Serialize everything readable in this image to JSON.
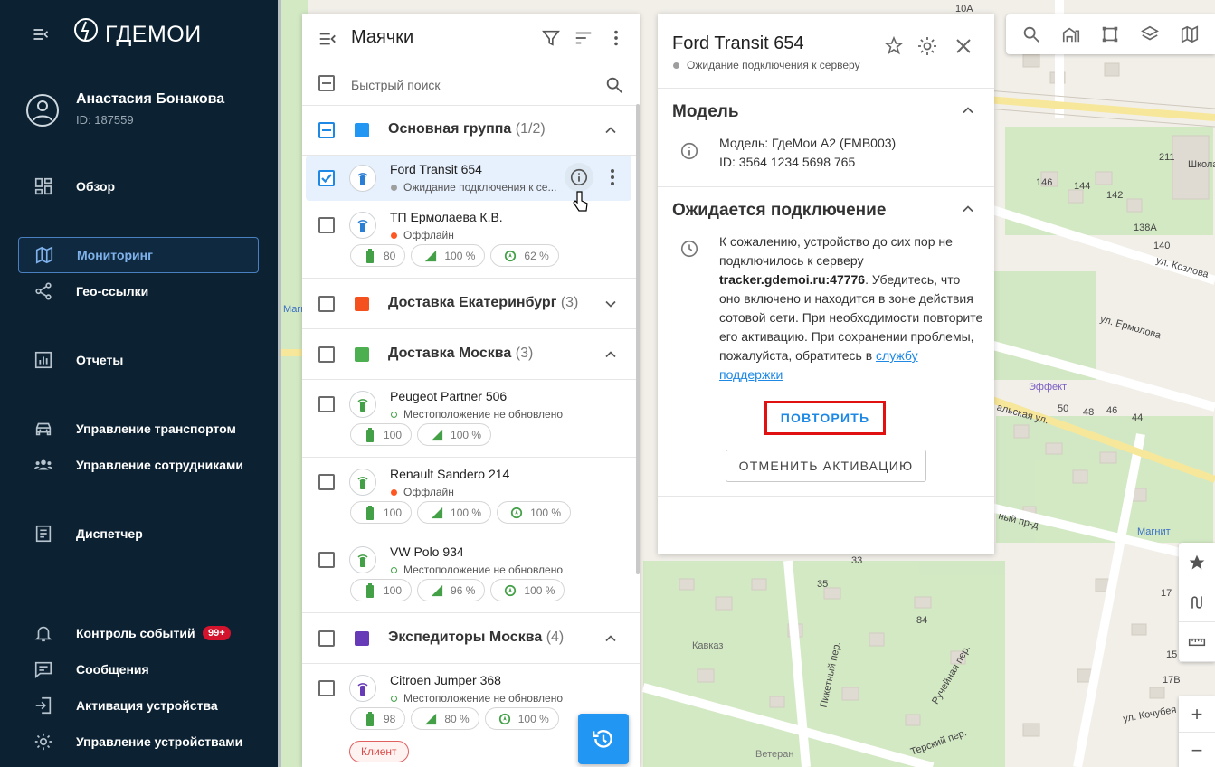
{
  "app": {
    "logo_text": "ГДЕМОИ"
  },
  "user": {
    "name": "Анастасия Бонакова",
    "id": "ID: 187559"
  },
  "nav": [
    {
      "key": "overview",
      "label": "Обзор",
      "icon": "dashboard-icon"
    },
    {
      "key": "monitoring",
      "label": "Мониторинг",
      "icon": "map-icon",
      "active": true
    },
    {
      "key": "geolinks",
      "label": "Гео-ссылки",
      "icon": "share-icon"
    },
    {
      "key": "reports",
      "label": "Отчеты",
      "icon": "reports-icon"
    },
    {
      "key": "vehicles",
      "label": "Управление транспортом",
      "icon": "car-icon"
    },
    {
      "key": "employees",
      "label": "Управление сотрудниками",
      "icon": "people-icon"
    },
    {
      "key": "dispatcher",
      "label": "Диспетчер",
      "icon": "clipboard-icon"
    },
    {
      "key": "events",
      "label": "Контроль событий",
      "icon": "bell-icon",
      "badge": "99+"
    },
    {
      "key": "messages",
      "label": "Сообщения",
      "icon": "message-icon"
    },
    {
      "key": "activation",
      "label": "Активация устройства",
      "icon": "login-icon"
    },
    {
      "key": "devices",
      "label": "Управление устройствами",
      "icon": "gear-icon"
    }
  ],
  "panel": {
    "title": "Маячки",
    "search_placeholder": "Быстрый поиск",
    "groups": [
      {
        "name": "Основная группа",
        "count": "(1/2)",
        "color": "#2196f3"
      },
      {
        "name": "Доставка Екатеринбург",
        "count": "(3)",
        "color": "#f4511e"
      },
      {
        "name": "Доставка Москва",
        "count": "(3)",
        "color": "#4caf50"
      },
      {
        "name": "Экспедиторы Москва",
        "count": "(4)",
        "color": "#673ab7"
      }
    ],
    "trackers": [
      {
        "name": "Ford Transit 654",
        "status": "Ожидание подключения к се..."
      },
      {
        "name": "ТП Ермолаева К.В.",
        "status": "Оффлайн",
        "battery": "80",
        "signal": "100 %",
        "gps": "62 %"
      },
      {
        "name": "Peugeot Partner 506",
        "status": "Местоположение не обновлено",
        "battery": "100",
        "signal": "100 %"
      },
      {
        "name": "Renault Sandero 214",
        "status": "Оффлайн",
        "battery": "100",
        "signal": "100 %",
        "gps": "100 %"
      },
      {
        "name": "VW Polo 934",
        "status": "Местоположение не обновлено",
        "battery": "100",
        "signal": "96 %",
        "gps": "100 %"
      },
      {
        "name": "Citroen Jumper 368",
        "status": "Местоположение не обновлено",
        "battery": "98",
        "signal": "80 %",
        "gps": "100 %",
        "tag": "Клиент"
      }
    ]
  },
  "details": {
    "title": "Ford Transit 654",
    "status": "Ожидание подключения к серверу",
    "model_header": "Модель",
    "model_line": "Модель: ГдеМои А2 (FMB003)",
    "id_line": "ID: 3564 1234 5698 765",
    "wait_header": "Ожидается подключение",
    "wait_text_1": "К сожалению, устройство до сих пор не подключилось к серверу",
    "server": "tracker.gdemoi.ru:47776",
    "wait_text_2": ". Убедитесь, что оно включено и находится в зоне действия сотовой сети. При необходимости повторите его активацию. При сохранении проблемы, пожалуйста, обратитесь в",
    "support_link": "службу поддержки",
    "retry": "ПОВТОРИТЬ",
    "cancel": "ОТМЕНИТЬ АКТИВАЦИЮ"
  },
  "map": {
    "labels": [
      "ул. Козлова",
      "ул. Ермолова",
      "Эффект",
      "альская ул.",
      "ный пр-д",
      "Магнит",
      "Школа",
      "Кавказ",
      "Пикетный пер.",
      "Ручейная пер.",
      "Терский пер.",
      "ул. Кочубея",
      "Ветеран",
      "Магн",
      "10А",
      "211",
      "146",
      "144",
      "142",
      "138А",
      "140",
      "50",
      "48",
      "46",
      "44",
      "33",
      "35",
      "84",
      "17",
      "17В",
      "15"
    ]
  },
  "colors": {
    "sidebar": "#0c2233",
    "accent": "#1e88e5",
    "highlight": "#e11111",
    "battery": "#43a047"
  }
}
